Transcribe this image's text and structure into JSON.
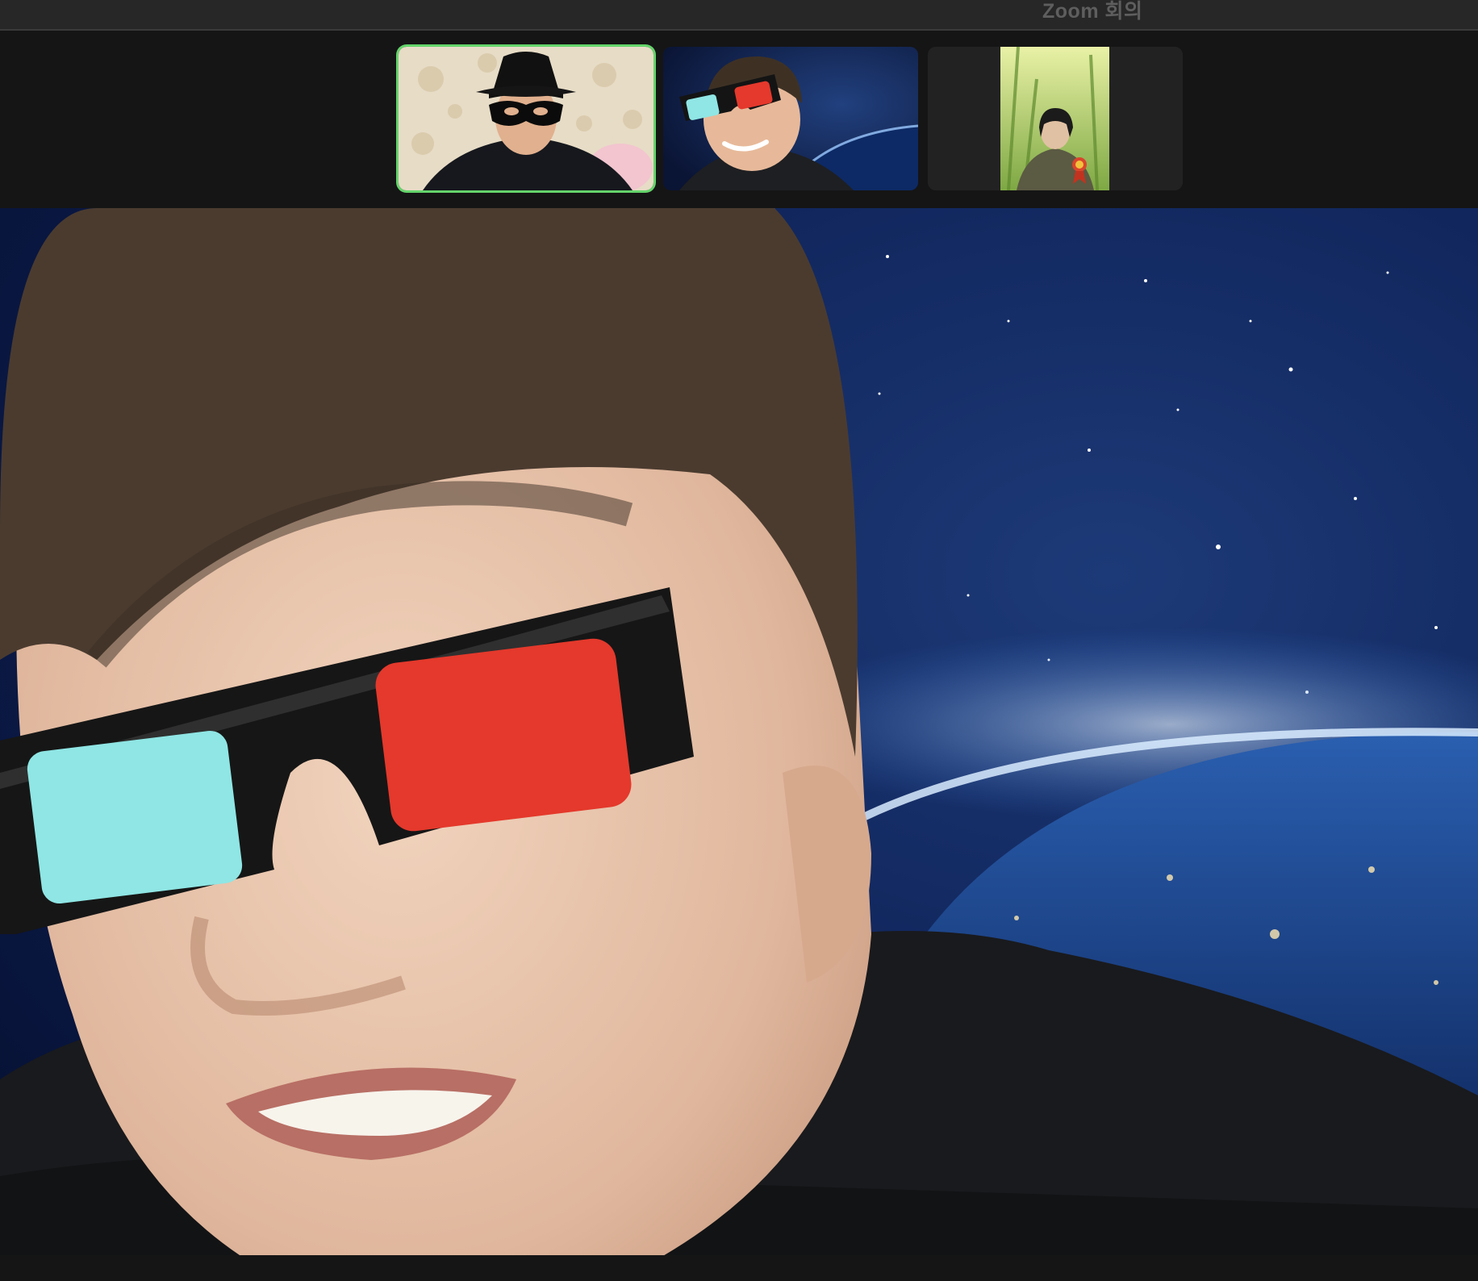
{
  "window": {
    "title": "Zoom 회의"
  },
  "participants": [
    {
      "tile": "thumbnail-1",
      "active_speaker": true,
      "effect": "bandit-hat-and-mask"
    },
    {
      "tile": "thumbnail-2",
      "active_speaker": false,
      "effect": "3d-glasses"
    },
    {
      "tile": "thumbnail-3",
      "active_speaker": false,
      "effect": "none"
    }
  ],
  "colors": {
    "active_border": "#64d46b",
    "background": "#101010",
    "title_text": "#5e5e5e",
    "lens_cyan": "#8fe6e4",
    "lens_red": "#e4392c",
    "space": "#0b1a44"
  },
  "icons": [
    "bandit-mask-icon",
    "3d-glasses-icon",
    "rosette-badge-icon"
  ]
}
